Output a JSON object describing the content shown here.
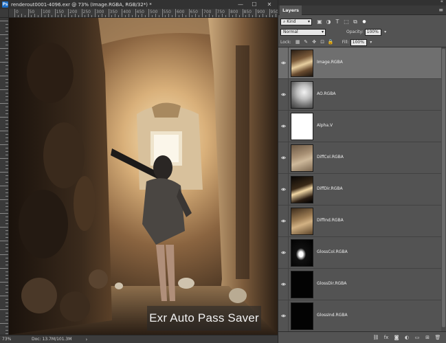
{
  "document": {
    "title": "renderout0001-4096.exr @ 73% (Image.RGBA, RGB/32*) *",
    "app_icon_text": "Ps",
    "window_buttons": [
      {
        "name": "minimize-button",
        "glyph": "—"
      },
      {
        "name": "maximize-button",
        "glyph": "☐"
      },
      {
        "name": "close-button",
        "glyph": "✕"
      }
    ],
    "ruler_labels": [
      "0",
      "50",
      "100",
      "150",
      "200",
      "250",
      "300",
      "350",
      "400",
      "450",
      "500",
      "550",
      "600",
      "650",
      "700",
      "750",
      "800",
      "850",
      "900",
      "950"
    ],
    "watermark": "Exr Auto Pass Saver",
    "status": {
      "zoom": "73%",
      "doc_size": "Doc: 13.7M/101.3M",
      "arrow": "›"
    }
  },
  "layers_panel": {
    "tab_label": "Layers",
    "close_glyph": "«",
    "menu_glyph": "≡",
    "filter": {
      "kind_label": "Kind",
      "icons": [
        "image-filter-icon",
        "adjustment-filter-icon",
        "type-filter-icon",
        "shape-filter-icon",
        "smart-object-filter-icon"
      ],
      "icon_glyphs": [
        "▣",
        "◑",
        "T",
        "⬚",
        "⧉"
      ],
      "toggle_glyph": "●"
    },
    "blend_mode": "Normal",
    "opacity_label": "Opacity:",
    "opacity_value": "100%",
    "lock_label": "Lock:",
    "lock_icons": [
      "lock-transparent-icon",
      "lock-paint-icon",
      "lock-position-icon",
      "lock-artboard-icon",
      "lock-all-icon"
    ],
    "lock_glyphs": [
      "▦",
      "✎",
      "✥",
      "⊡",
      "🔒"
    ],
    "fill_label": "Fill:",
    "fill_value": "100%",
    "layers": [
      {
        "name": "Image.RGBA",
        "thumb": "image",
        "selected": true
      },
      {
        "name": "AO.RGBA",
        "thumb": "ao",
        "selected": false
      },
      {
        "name": "Alpha.V",
        "thumb": "white",
        "selected": false
      },
      {
        "name": "DiffCol.RGBA",
        "thumb": "diffcol",
        "selected": false
      },
      {
        "name": "DiffDir.RGBA",
        "thumb": "diffdir",
        "selected": false
      },
      {
        "name": "DiffInd.RGBA",
        "thumb": "diffind",
        "selected": false
      },
      {
        "name": "GlossCol.RGBA",
        "thumb": "glosscol",
        "selected": false
      },
      {
        "name": "GlossDir.RGBA",
        "thumb": "black",
        "selected": false
      },
      {
        "name": "GlossInd.RGBA",
        "thumb": "black",
        "selected": false
      }
    ],
    "footer_buttons": [
      {
        "name": "link-layers-button",
        "glyph": "⛓"
      },
      {
        "name": "layer-style-button",
        "glyph": "fx"
      },
      {
        "name": "add-mask-button",
        "glyph": "◙"
      },
      {
        "name": "adjustment-layer-button",
        "glyph": "◐"
      },
      {
        "name": "new-group-button",
        "glyph": "▭"
      },
      {
        "name": "new-layer-button",
        "glyph": "⊞"
      },
      {
        "name": "delete-layer-button",
        "glyph": "🗑"
      }
    ]
  },
  "colors": {
    "workspace": "#535353",
    "chrome": "#323232",
    "selected_layer": "#6f6f6f",
    "accent": "#1d6fc7"
  }
}
